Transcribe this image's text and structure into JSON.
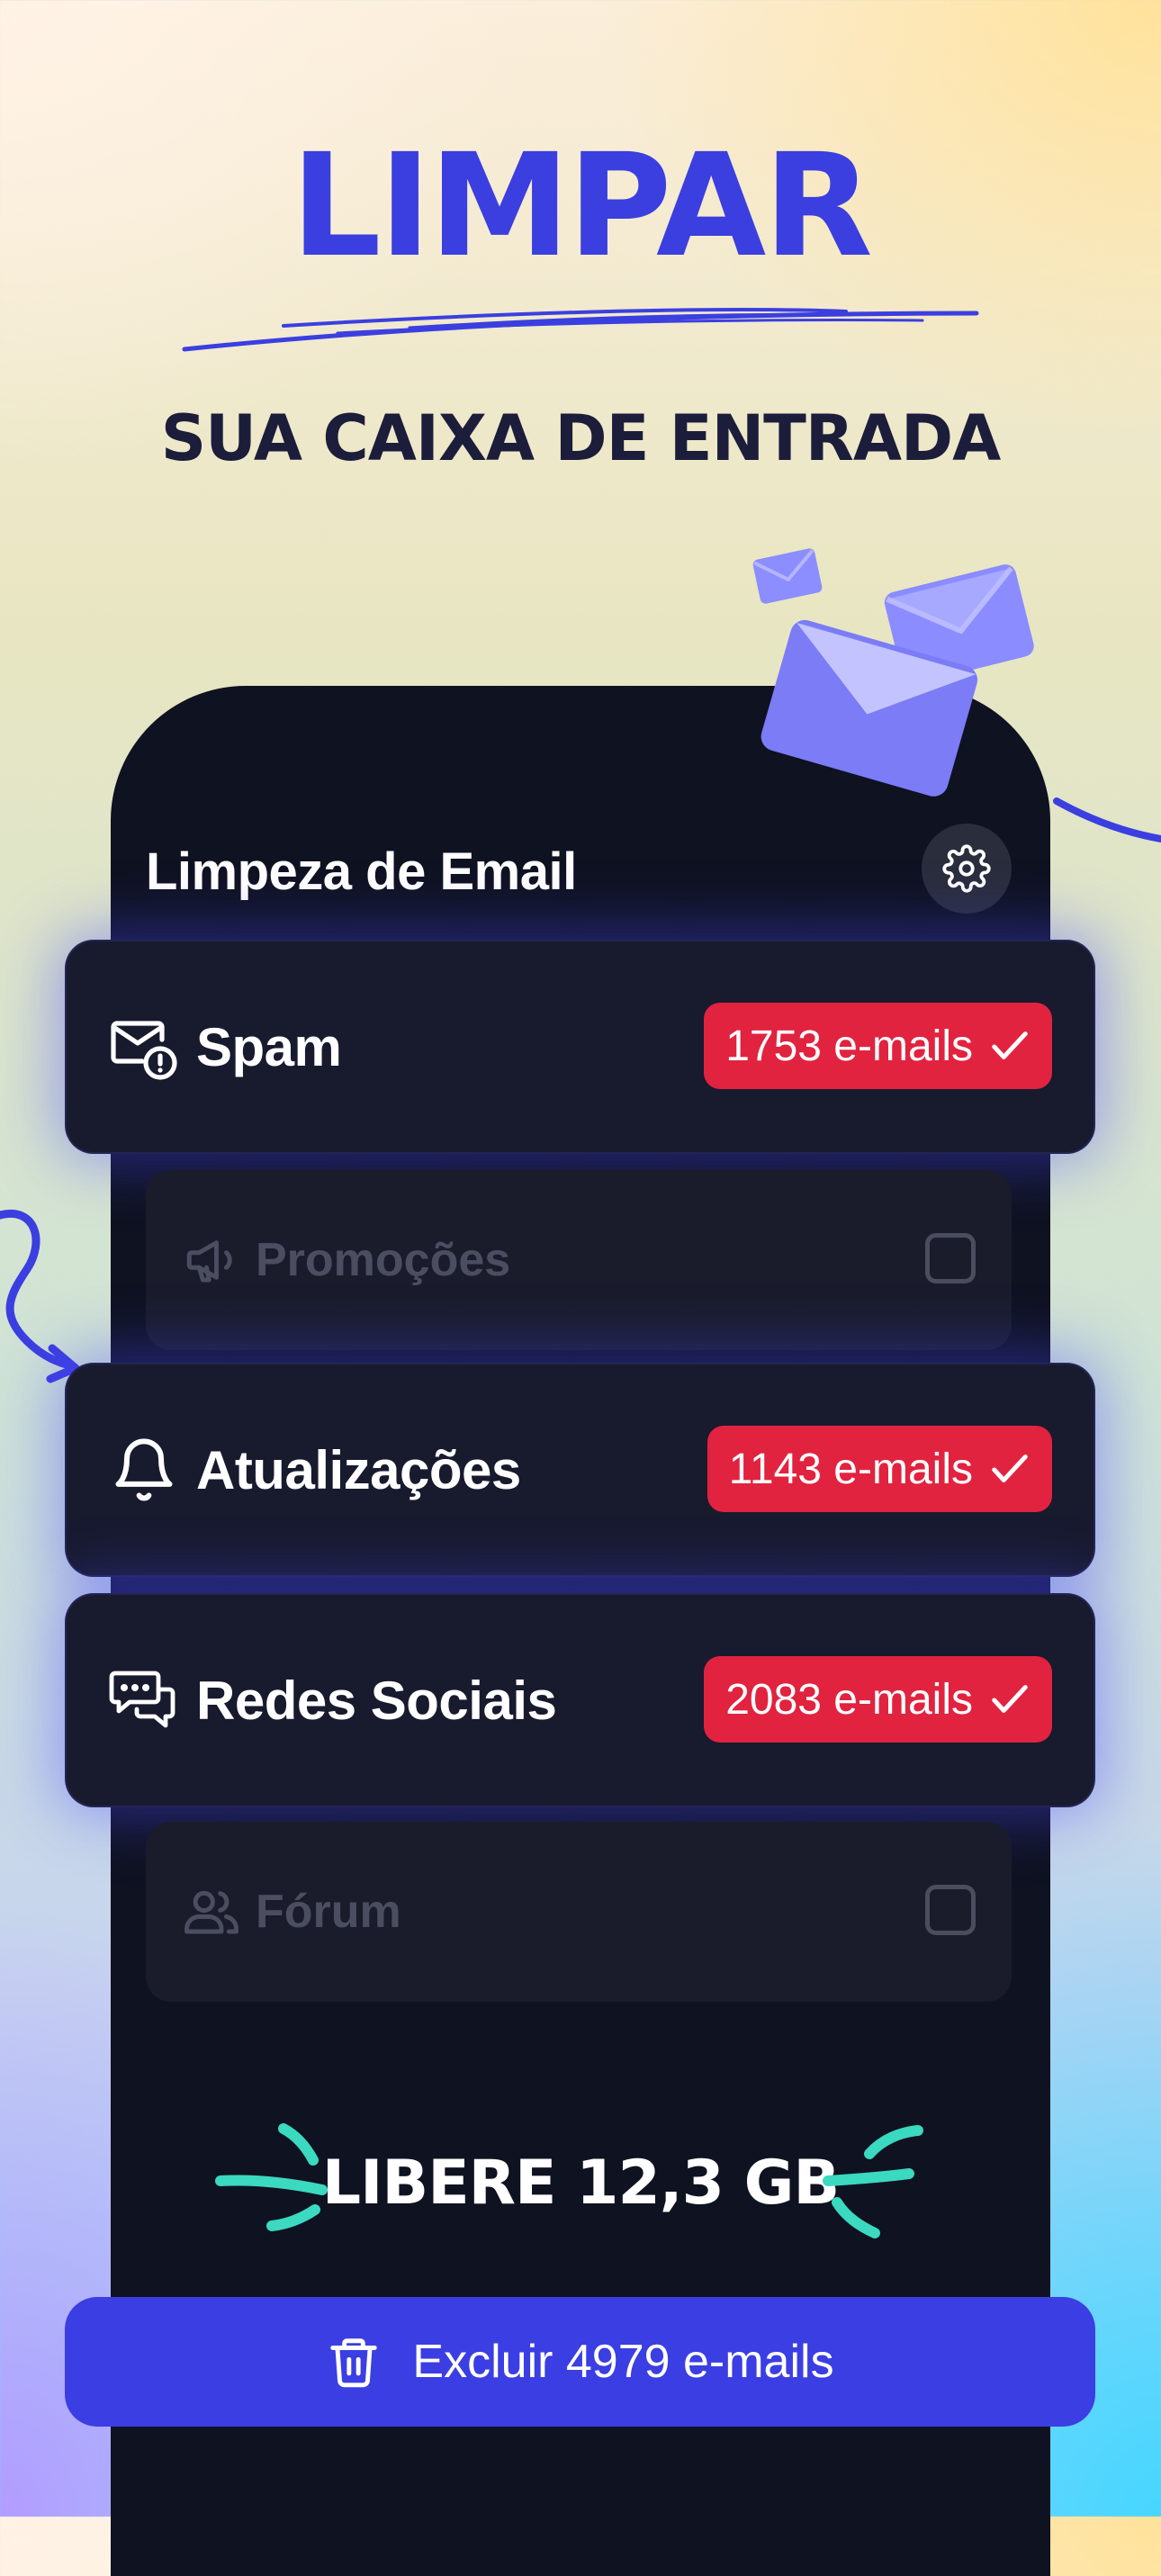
{
  "hero": {
    "title": "LIMPAR",
    "subtitle": "SUA CAIXA DE ENTRADA"
  },
  "app": {
    "title": "Limpeza de Email",
    "settings_icon": "gear-icon"
  },
  "categories": [
    {
      "label": "Spam",
      "icon": "mail-alert-icon",
      "count": "1753 e-mails",
      "selected": true
    },
    {
      "label": "Promoções",
      "icon": "megaphone-icon",
      "selected": false
    },
    {
      "label": "Atualizações",
      "icon": "bell-icon",
      "count": "1143 e-mails",
      "selected": true
    },
    {
      "label": "Redes Sociais",
      "icon": "chat-bubbles-icon",
      "count": "2083 e-mails",
      "selected": true
    },
    {
      "label": "Fórum",
      "icon": "users-icon",
      "selected": false
    }
  ],
  "summary": {
    "free_space": "LIBERE 12,3 GB"
  },
  "cta": {
    "label": "Excluir 4979 e-mails",
    "icon": "trash-icon"
  },
  "colors": {
    "accent": "#3b3ee3",
    "badge": "#e1233f",
    "phone_bg": "#0f1220",
    "sparkle": "#3ad9c0"
  }
}
